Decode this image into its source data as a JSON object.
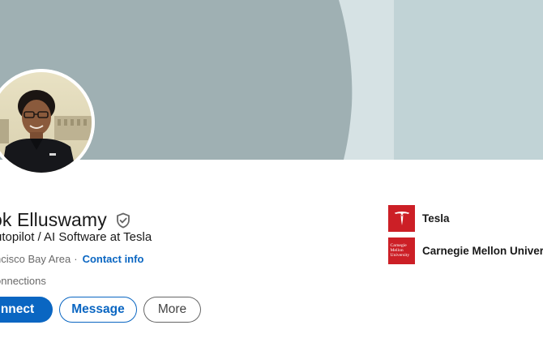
{
  "profile": {
    "name": "ok Elluswamy",
    "headline": "utopilot / AI Software at Tesla",
    "location": "ncisco Bay Area",
    "separator": "·",
    "contact_info": "Contact info",
    "connections": "onnections"
  },
  "actions": {
    "connect": "nnect",
    "message": "Message",
    "more": "More"
  },
  "organizations": [
    {
      "name": "Tesla",
      "logo_icon": "tesla-logo-icon"
    },
    {
      "name": "Carnegie Mellon Univer",
      "logo_icon": "cmu-logo-icon",
      "logo_text": [
        "Carnegie",
        "Mellon",
        "University"
      ]
    }
  ],
  "colors": {
    "brand_blue": "#0a66c2",
    "banner_gray": "#9fb0b3",
    "banner_light": "#c1d3d6",
    "logo_red": "#cc1f26"
  }
}
